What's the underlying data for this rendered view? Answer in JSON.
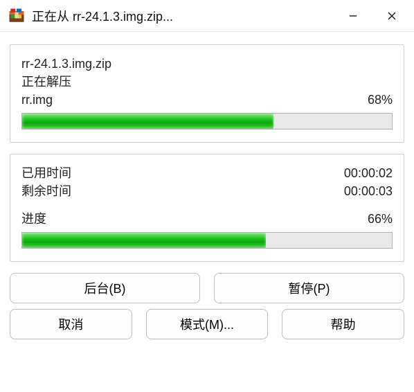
{
  "titlebar": {
    "title": "正在从 rr-24.1.3.img.zip..."
  },
  "file": {
    "archive": "rr-24.1.3.img.zip",
    "action_label": "正在解压",
    "current_file": "rr.img",
    "file_percent": "68%",
    "file_percent_value": 68
  },
  "time": {
    "elapsed_label": "已用时间",
    "elapsed_value": "00:00:02",
    "remaining_label": "剩余时间",
    "remaining_value": "00:00:03"
  },
  "progress": {
    "label": "进度",
    "percent": "66%",
    "percent_value": 66
  },
  "buttons": {
    "background": "后台(B)",
    "pause": "暂停(P)",
    "cancel": "取消",
    "mode": "模式(M)...",
    "help": "帮助"
  }
}
